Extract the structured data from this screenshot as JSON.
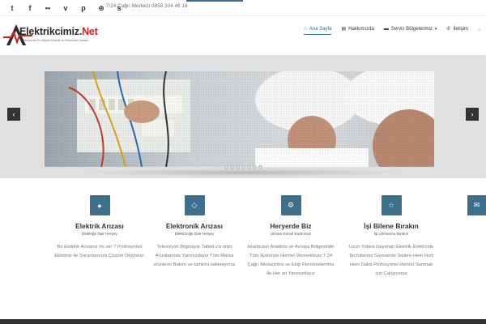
{
  "topbar": {
    "social": [
      {
        "icon": "twitter-icon",
        "glyph": "t"
      },
      {
        "icon": "facebook-icon",
        "glyph": "f"
      },
      {
        "icon": "flickr-icon",
        "glyph": "••"
      },
      {
        "icon": "vimeo-icon",
        "glyph": "v"
      },
      {
        "icon": "pinterest-icon",
        "glyph": "p"
      },
      {
        "icon": "dribbble-icon",
        "glyph": "⊕"
      },
      {
        "icon": "skype-icon",
        "glyph": "s"
      }
    ],
    "callcenter": "7/24 Çağrı Merkezi 0850 304 46 16"
  },
  "header": {
    "logo_main": "Elektrikcimiz.",
    "logo_net": "Net",
    "logo_sub": "Türkiye'nin En Büyük Elektrik ve Elektronik Uzmanı",
    "nav": [
      {
        "label": "Ana Sayfa",
        "icon": "home-icon",
        "glyph": "⌂",
        "active": true
      },
      {
        "label": "Hakkımızda",
        "icon": "briefcase-icon",
        "glyph": "▤",
        "active": false
      },
      {
        "label": "Servis Bölgelerimiz",
        "icon": "truck-icon",
        "glyph": "▬",
        "active": false,
        "caret": "▾"
      },
      {
        "label": "İletişim",
        "icon": "phone-icon",
        "glyph": "✆",
        "active": false
      }
    ]
  },
  "slider": {
    "prev": "‹",
    "next": "›",
    "dots": 7
  },
  "features": [
    {
      "title": "Elektrik Arızası",
      "subtitle": "Elektriğe Dair Herşey",
      "icon": "drop-icon",
      "glyph": "💧",
      "text": "Bir Elektrik Arızanız mı var ? Profosyonel Ekibimiz ile Sorunlarınıza Çözüm Oluyoruz."
    },
    {
      "title": "Elektronik Arızası",
      "subtitle": "Elektroniğe Dair Herşey",
      "icon": "diamond-icon",
      "glyph": "◇",
      "text": "Televizyon Bilgisayar Tablet v.b ürün Arızalarında Yanınızdayız Tüm Marka ürünlerin Bakım ve tamirini üstleniyoruz"
    },
    {
      "title": "Heryerde Biz",
      "subtitle": "Uzman Servis Kadromuz",
      "icon": "gear-icon",
      "glyph": "⚙",
      "text": "İstanbulun Anadolu ve Avrupa Bölgesinde Tüm İlçelerine Hizmet Vermekteyiz 7 24 Çağrı Merkezimiz ve Ekip Personellerimiz İle Her an Yanınızdayız"
    },
    {
      "title": "İşi Bilene Bırakın",
      "subtitle": "İşi Uzmanına Bırakın",
      "icon": "star-icon",
      "glyph": "☆",
      "text": "Uzun Yıllara Dayanan Elektrik Elektronik Tecrübemiz Sayesinde Sizlere Hem Hızlı Hem Daha Profosyonel Hizmet Sunmak için Çalışıyoruz"
    }
  ],
  "colors": {
    "accent": "#3e6f8c",
    "logo_net": "#cc2222"
  }
}
